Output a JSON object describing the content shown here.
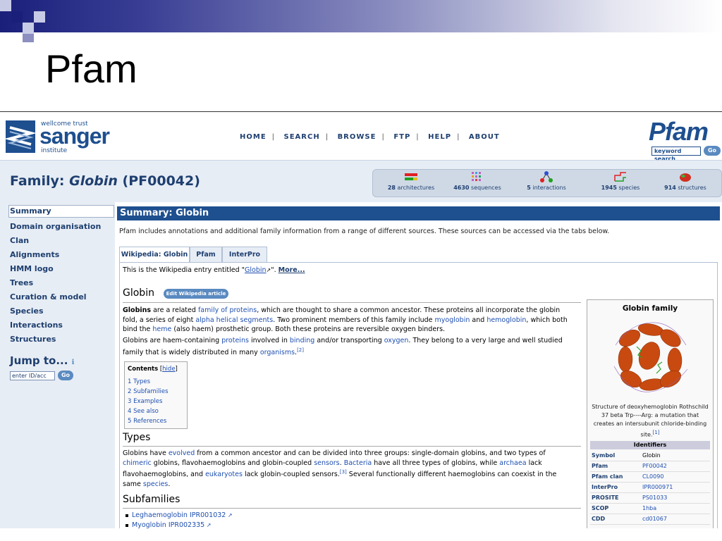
{
  "slide": {
    "title": "Pfam"
  },
  "header": {
    "sanger_small": "wellcome trust",
    "sanger_big": "sanger",
    "sanger_institute": "institute",
    "nav": [
      "HOME",
      "SEARCH",
      "BROWSE",
      "FTP",
      "HELP",
      "ABOUT"
    ],
    "pfam_logo": "Pfam",
    "keyword_search": "keyword search",
    "go": "Go"
  },
  "family": {
    "title_prefix": "Family: ",
    "name": "Globin",
    "accession": " (PF00042)"
  },
  "stats": [
    {
      "count": "28",
      "label": "architectures"
    },
    {
      "count": "4630",
      "label": "sequences"
    },
    {
      "count": "5",
      "label": "interactions"
    },
    {
      "count": "1945",
      "label": "species"
    },
    {
      "count": "914",
      "label": "structures"
    }
  ],
  "sidebar": {
    "items": [
      "Summary",
      "Domain organisation",
      "Clan",
      "Alignments",
      "HMM logo",
      "Trees",
      "Curation & model",
      "Species",
      "Interactions",
      "Structures"
    ],
    "jump_label": "Jump to...",
    "jump_placeholder": "enter ID/acc",
    "jump_go": "Go"
  },
  "summary": {
    "heading": "Summary: Globin",
    "intro": "Pfam includes annotations and additional family information from a range of different sources. These sources can be accessed via the tabs below.",
    "tabs": [
      "Wikipedia: Globin",
      "Pfam",
      "InterPro"
    ]
  },
  "wiki": {
    "entry_prefix": "This is the Wikipedia entry entitled \"",
    "entry_link": "Globin",
    "entry_suffix": "\". ",
    "more": "More...",
    "heading": "Globin",
    "edit_btn": "Edit Wikipedia article",
    "para1": {
      "b": "Globins",
      "t1": " are a related ",
      "l1": "family of proteins",
      "t2": ", which are thought to share a common ancestor. These proteins all incorporate the globin",
      "t3": "fold, a series of eight ",
      "l2": "alpha helical segments",
      "t4": ". Two prominent members of this family include ",
      "l3": "myoglobin",
      "t5": " and ",
      "l4": "hemoglobin",
      "t6": ", which both",
      "t7": "bind the ",
      "l5": "heme",
      "t8": " (also haem) prosthetic group. Both these proteins are reversible oxygen binders."
    },
    "para2": {
      "t1": "Globins are haem-containing ",
      "l1": "proteins",
      "t2": " involved in ",
      "l2": "binding",
      "t3": " and/or transporting ",
      "l3": "oxygen",
      "t4": ". They belong to a very large and well studied",
      "t5": "family that is widely distributed in many ",
      "l4": "organisms",
      "t6": ".",
      "ref": "[2]"
    },
    "toc": {
      "title": "Contents",
      "hide": "hide",
      "items": [
        "1 Types",
        "2 Subfamilies",
        "3 Examples",
        "4 See also",
        "5 References"
      ]
    },
    "types_heading": "Types",
    "types": {
      "t1": "Globins have ",
      "l1": "evolved",
      "t2": " from a common ancestor and can be divided into three groups: single-domain globins, and two types of",
      "l2": "chimeric",
      "t3": " globins, flavohaemoglobins and globin-coupled ",
      "l3": "sensors",
      "t4": ". ",
      "l4": "Bacteria",
      "t5": " have all three types of globins, while ",
      "l5": "archaea",
      "t6": " lack",
      "t7": "flavohaemoglobins, and ",
      "l6": "eukaryotes",
      "t8": " lack globin-coupled sensors.",
      "ref": "[3]",
      "t9": " Several functionally different haemoglobins can coexist in the",
      "t10": "same ",
      "l7": "species",
      "t11": "."
    },
    "subfamilies_heading": "Subfamilies",
    "subfamilies": [
      "Leghaemoglobin IPR001032",
      "Myoglobin IPR002335"
    ]
  },
  "infobox": {
    "title": "Globin family",
    "caption": "Structure of deoxyhemoglobin Rothschild 37 beta Trp----Arg: a mutation that creates an intersubunit chloride-binding site.",
    "caption_ref": "[1]",
    "identifiers": "Identifiers",
    "rows": [
      {
        "k": "Symbol",
        "v": "Globin"
      },
      {
        "k": "Pfam",
        "v": "PF00042"
      },
      {
        "k": "Pfam clan",
        "v": "CL0090"
      },
      {
        "k": "InterPro",
        "v": "IPR000971"
      },
      {
        "k": "PROSITE",
        "v": "PS01033"
      },
      {
        "k": "SCOP",
        "v": "1hba"
      },
      {
        "k": "CDD",
        "v": "cd01067"
      }
    ]
  },
  "colors": {
    "brand_blue": "#1e4f8f",
    "link_blue": "#1e4fb0",
    "sidebar_bg": "#e7edf5"
  }
}
